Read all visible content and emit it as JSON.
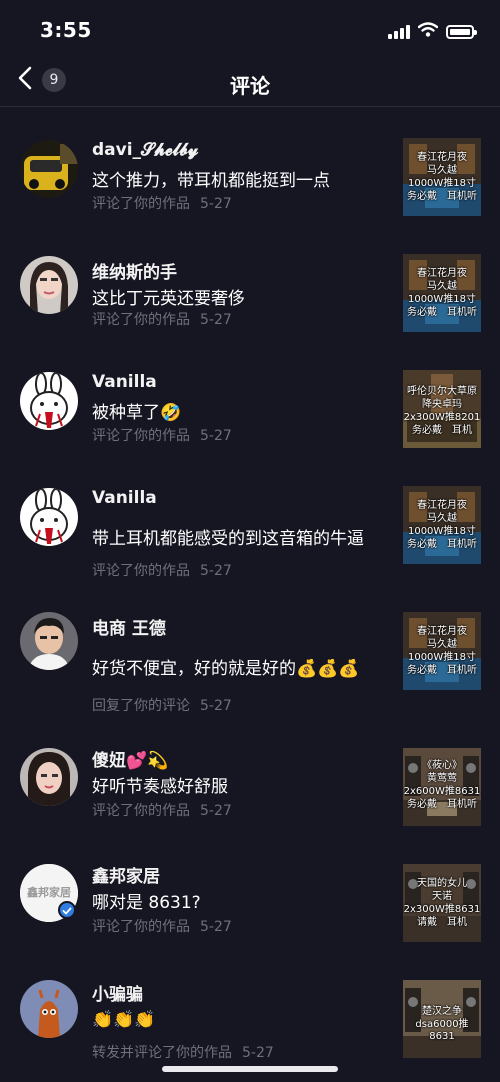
{
  "status_bar": {
    "time": "3:55"
  },
  "nav": {
    "back_count": "9",
    "title": "评论"
  },
  "comments": [
    {
      "name": "davi_𝓢𝓱𝓮𝓵𝓫𝔂",
      "text": "这个推力，带耳机都能挺到一点",
      "action": "评论了你的作品",
      "date": "5-27",
      "thumb": {
        "lines": [
          "春江花月夜",
          "马久越",
          "1000W推18寸",
          "务必戴　耳机听"
        ]
      }
    },
    {
      "name": "维纳斯的手",
      "text": "这比丁元英还要奢侈",
      "action": "评论了你的作品",
      "date": "5-27",
      "thumb": {
        "lines": [
          "春江花月夜",
          "马久越",
          "1000W推18寸",
          "务必戴　耳机听"
        ]
      }
    },
    {
      "name": "Vanilla",
      "text": "被种草了🤣",
      "action": "评论了你的作品",
      "date": "5-27",
      "thumb": {
        "lines": [
          "呼伦贝尔大草原",
          "降央卓玛",
          "2x300W推8201",
          "务必戴　耳机"
        ]
      }
    },
    {
      "name": "Vanilla",
      "text": "带上耳机都能感受的到这音箱的牛逼",
      "action": "评论了你的作品",
      "date": "5-27",
      "thumb": {
        "lines": [
          "春江花月夜",
          "马久越",
          "1000W推18寸",
          "务必戴　耳机听"
        ]
      }
    },
    {
      "name": "电商 王德",
      "text": "好货不便宜，好的就是好的💰💰💰",
      "action": "回复了你的评论",
      "date": "5-27",
      "thumb": {
        "lines": [
          "春江花月夜",
          "马久越",
          "1000W推18寸",
          "务必戴　耳机听"
        ]
      }
    },
    {
      "name": "傻妞💕💫",
      "text": "好听节奏感好舒服",
      "action": "评论了你的作品",
      "date": "5-27",
      "thumb": {
        "lines": [
          "《莜心》",
          "黄莺莺",
          "2x600W推8631",
          "务必戴　耳机听"
        ]
      }
    },
    {
      "name": "鑫邦家居",
      "text": "哪对是 8631?",
      "action": "评论了你的作品",
      "date": "5-27",
      "avatar_text": "鑫邦家居",
      "thumb": {
        "lines": [
          "天国的女儿",
          "天诺",
          "2x300W推8631",
          "请戴　耳机"
        ]
      }
    },
    {
      "name": "小骗骗",
      "text": "👏👏👏",
      "action": "转发并评论了你的作品",
      "date": "5-27",
      "thumb": {
        "lines": [
          "楚汉之争",
          "dsa6000推8631"
        ]
      }
    }
  ],
  "colors": {
    "background": "#161622",
    "meta": "#6f6f7d",
    "divider": "#2a2a38"
  }
}
